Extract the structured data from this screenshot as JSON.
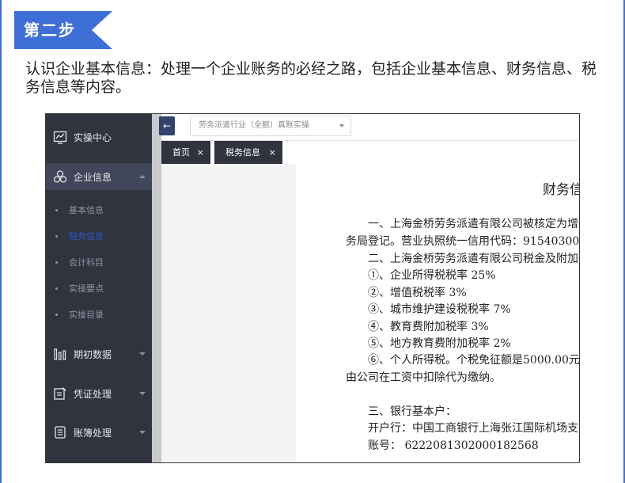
{
  "step": {
    "label": "第二步"
  },
  "intro": {
    "text": "认识企业基本信息：处理一个企业账务的必经之路，包括企业基本信息、财务信息、税务信息等内容。"
  },
  "colors": {
    "frame": "#3e6fd6",
    "sidebar_bg": "#30343f",
    "sidebar_active": "#41465a",
    "current_sub": "#2a56c6"
  },
  "sidebar": {
    "home": {
      "label": "实操中心",
      "icon": "chart-board-icon"
    },
    "company": {
      "label": "企业信息",
      "icon": "org-icon",
      "sub_items": [
        "基本信息",
        "税务信息",
        "会计科目",
        "实操要点",
        "实操目录"
      ],
      "current": "税务信息"
    },
    "opening": {
      "label": "期初数据",
      "icon": "bar-chart-icon"
    },
    "voucher": {
      "label": "凭证处理",
      "icon": "voucher-edit-icon"
    },
    "ledger": {
      "label": "账簿处理",
      "icon": "ledger-book-icon"
    }
  },
  "topbar": {
    "industry_select": "劳务派遣行业（全额）真账实操",
    "collapse_icon": "arrow-left-icon"
  },
  "tabs": [
    {
      "label": "首页",
      "close": "×"
    },
    {
      "label": "税务信息",
      "close": "×"
    }
  ],
  "document": {
    "title": "财务信",
    "lines": [
      "一、上海金桥劳务派遣有限公司被核定为增",
      "务局登记。营业执照统一信用代码：91540300",
      "二、上海金桥劳务派遣有限公司税金及附加",
      "①、企业所得税税率      25%",
      "②、增值税税率            3%",
      "③、城市维护建设税税率 7%",
      "④、教育费附加税率       3%",
      "⑤、地方教育费附加税率 2%",
      "⑥、个人所得税。个税免征额是5000.00元，",
      "由公司在工资中扣除代为缴纳。",
      "三、银行基本户：",
      "开户行：中国工商银行上海张江国际机场支",
      "账号：  6222081302000182568"
    ]
  }
}
